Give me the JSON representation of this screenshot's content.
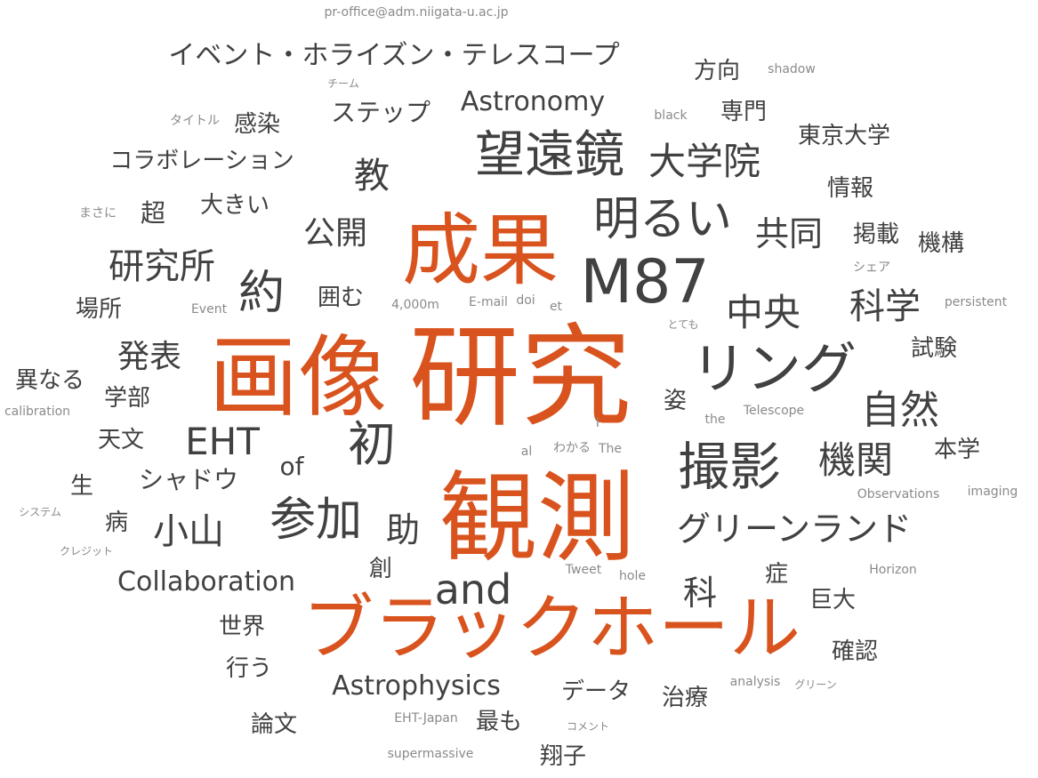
{
  "colors": {
    "accent": "#d9531e",
    "dark": "#414141",
    "mid": "#606060",
    "light": "#8a8a8a"
  },
  "words": [
    {
      "text": "研究",
      "tier": "accent"
    },
    {
      "text": "画像",
      "tier": "accent"
    },
    {
      "text": "成果",
      "tier": "accent"
    },
    {
      "text": "観測",
      "tier": "accent"
    },
    {
      "text": "ブラックホール",
      "tier": "accent"
    },
    {
      "text": "M87",
      "tier": "dark"
    },
    {
      "text": "リング",
      "tier": "dark"
    },
    {
      "text": "望遠鏡",
      "tier": "dark"
    },
    {
      "text": "明るい",
      "tier": "dark"
    },
    {
      "text": "撮影",
      "tier": "dark"
    },
    {
      "text": "and",
      "tier": "dark"
    },
    {
      "text": "参加",
      "tier": "dark"
    },
    {
      "text": "約",
      "tier": "dark"
    },
    {
      "text": "初",
      "tier": "dark"
    },
    {
      "text": "EHT",
      "tier": "dark"
    },
    {
      "text": "大学院",
      "tier": "dark"
    },
    {
      "text": "中央",
      "tier": "dark"
    },
    {
      "text": "科学",
      "tier": "dark"
    },
    {
      "text": "自然",
      "tier": "dark"
    },
    {
      "text": "機関",
      "tier": "dark"
    },
    {
      "text": "小山",
      "tier": "dark"
    },
    {
      "text": "研究所",
      "tier": "dark"
    },
    {
      "text": "発表",
      "tier": "dark"
    },
    {
      "text": "共同",
      "tier": "dark"
    },
    {
      "text": "公開",
      "tier": "dark"
    },
    {
      "text": "教",
      "tier": "dark"
    },
    {
      "text": "科",
      "tier": "dark"
    },
    {
      "text": "助",
      "tier": "dark"
    },
    {
      "text": "グリーンランド",
      "tier": "dark"
    },
    {
      "text": "イベント・ホライズン・テレスコープ",
      "tier": "dark"
    },
    {
      "text": "Astronomy",
      "tier": "dark"
    },
    {
      "text": "Astrophysics",
      "tier": "dark"
    },
    {
      "text": "Collaboration",
      "tier": "dark"
    },
    {
      "text": "コラボレーション",
      "tier": "dark"
    },
    {
      "text": "ステップ",
      "tier": "dark"
    },
    {
      "text": "シャドウ",
      "tier": "dark"
    },
    {
      "text": "東京大学",
      "tier": "dark"
    },
    {
      "text": "方向",
      "tier": "dark"
    },
    {
      "text": "専門",
      "tier": "dark"
    },
    {
      "text": "感染",
      "tier": "dark"
    },
    {
      "text": "大きい",
      "tier": "dark"
    },
    {
      "text": "超",
      "tier": "dark"
    },
    {
      "text": "情報",
      "tier": "dark"
    },
    {
      "text": "掲載",
      "tier": "dark"
    },
    {
      "text": "機構",
      "tier": "dark"
    },
    {
      "text": "囲む",
      "tier": "dark"
    },
    {
      "text": "場所",
      "tier": "dark"
    },
    {
      "text": "異なる",
      "tier": "dark"
    },
    {
      "text": "学部",
      "tier": "dark"
    },
    {
      "text": "天文",
      "tier": "dark"
    },
    {
      "text": "試験",
      "tier": "dark"
    },
    {
      "text": "姿",
      "tier": "dark"
    },
    {
      "text": "本学",
      "tier": "dark"
    },
    {
      "text": "of",
      "tier": "dark"
    },
    {
      "text": "生",
      "tier": "dark"
    },
    {
      "text": "病",
      "tier": "dark"
    },
    {
      "text": "創",
      "tier": "dark"
    },
    {
      "text": "症",
      "tier": "dark"
    },
    {
      "text": "巨大",
      "tier": "dark"
    },
    {
      "text": "世界",
      "tier": "dark"
    },
    {
      "text": "行う",
      "tier": "dark"
    },
    {
      "text": "確認",
      "tier": "dark"
    },
    {
      "text": "データ",
      "tier": "dark"
    },
    {
      "text": "治療",
      "tier": "dark"
    },
    {
      "text": "論文",
      "tier": "dark"
    },
    {
      "text": "最も",
      "tier": "dark"
    },
    {
      "text": "翔子",
      "tier": "dark"
    },
    {
      "text": "pr-office@adm.niigata-u.ac.jp",
      "tier": "light"
    },
    {
      "text": "shadow",
      "tier": "light"
    },
    {
      "text": "チーム",
      "tier": "light"
    },
    {
      "text": "タイトル",
      "tier": "light"
    },
    {
      "text": "black",
      "tier": "light"
    },
    {
      "text": "まさに",
      "tier": "light"
    },
    {
      "text": "シェア",
      "tier": "light"
    },
    {
      "text": "persistent",
      "tier": "light"
    },
    {
      "text": "Event",
      "tier": "light"
    },
    {
      "text": "4,000m",
      "tier": "light"
    },
    {
      "text": "E-mail",
      "tier": "light"
    },
    {
      "text": "doi",
      "tier": "light"
    },
    {
      "text": "et",
      "tier": "light"
    },
    {
      "text": "とても",
      "tier": "light"
    },
    {
      "text": "calibration",
      "tier": "light"
    },
    {
      "text": "the",
      "tier": "light"
    },
    {
      "text": "Telescope",
      "tier": "light"
    },
    {
      "text": "I",
      "tier": "light"
    },
    {
      "text": "al",
      "tier": "light"
    },
    {
      "text": "わかる",
      "tier": "light"
    },
    {
      "text": "The",
      "tier": "light"
    },
    {
      "text": "Observations",
      "tier": "light"
    },
    {
      "text": "imaging",
      "tier": "light"
    },
    {
      "text": "システム",
      "tier": "light"
    },
    {
      "text": "クレジット",
      "tier": "light"
    },
    {
      "text": "Tweet",
      "tier": "light"
    },
    {
      "text": "hole",
      "tier": "light"
    },
    {
      "text": "Horizon",
      "tier": "light"
    },
    {
      "text": "analysis",
      "tier": "light"
    },
    {
      "text": "グリーン",
      "tier": "light"
    },
    {
      "text": "EHT-Japan",
      "tier": "light"
    },
    {
      "text": "コメント",
      "tier": "light"
    },
    {
      "text": "supermassive",
      "tier": "light"
    }
  ]
}
